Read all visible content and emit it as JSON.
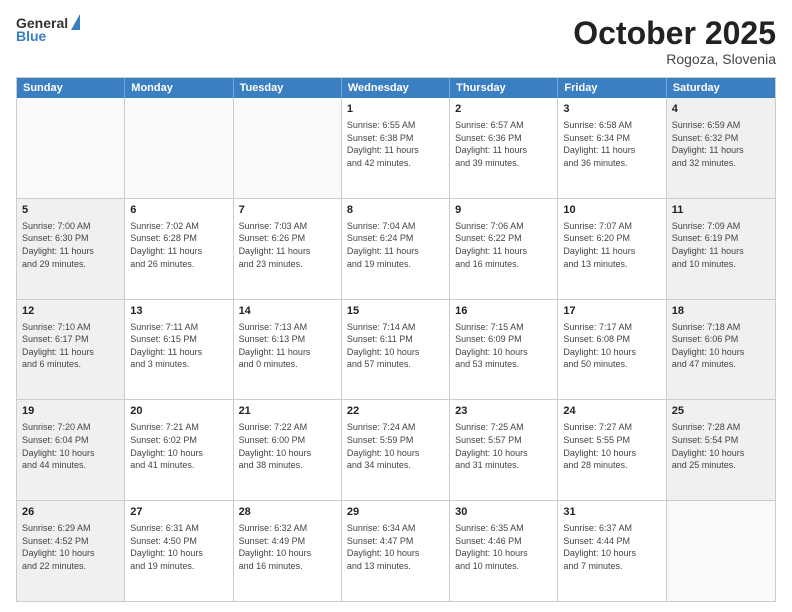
{
  "logo": {
    "line1": "General",
    "line2": "Blue"
  },
  "header": {
    "month": "October 2025",
    "location": "Rogoza, Slovenia"
  },
  "weekdays": [
    "Sunday",
    "Monday",
    "Tuesday",
    "Wednesday",
    "Thursday",
    "Friday",
    "Saturday"
  ],
  "rows": [
    [
      {
        "day": "",
        "info": "",
        "empty": true
      },
      {
        "day": "",
        "info": "",
        "empty": true
      },
      {
        "day": "",
        "info": "",
        "empty": true
      },
      {
        "day": "1",
        "info": "Sunrise: 6:55 AM\nSunset: 6:38 PM\nDaylight: 11 hours\nand 42 minutes.",
        "shaded": false
      },
      {
        "day": "2",
        "info": "Sunrise: 6:57 AM\nSunset: 6:36 PM\nDaylight: 11 hours\nand 39 minutes.",
        "shaded": false
      },
      {
        "day": "3",
        "info": "Sunrise: 6:58 AM\nSunset: 6:34 PM\nDaylight: 11 hours\nand 36 minutes.",
        "shaded": false
      },
      {
        "day": "4",
        "info": "Sunrise: 6:59 AM\nSunset: 6:32 PM\nDaylight: 11 hours\nand 32 minutes.",
        "shaded": true
      }
    ],
    [
      {
        "day": "5",
        "info": "Sunrise: 7:00 AM\nSunset: 6:30 PM\nDaylight: 11 hours\nand 29 minutes.",
        "shaded": true
      },
      {
        "day": "6",
        "info": "Sunrise: 7:02 AM\nSunset: 6:28 PM\nDaylight: 11 hours\nand 26 minutes.",
        "shaded": false
      },
      {
        "day": "7",
        "info": "Sunrise: 7:03 AM\nSunset: 6:26 PM\nDaylight: 11 hours\nand 23 minutes.",
        "shaded": false
      },
      {
        "day": "8",
        "info": "Sunrise: 7:04 AM\nSunset: 6:24 PM\nDaylight: 11 hours\nand 19 minutes.",
        "shaded": false
      },
      {
        "day": "9",
        "info": "Sunrise: 7:06 AM\nSunset: 6:22 PM\nDaylight: 11 hours\nand 16 minutes.",
        "shaded": false
      },
      {
        "day": "10",
        "info": "Sunrise: 7:07 AM\nSunset: 6:20 PM\nDaylight: 11 hours\nand 13 minutes.",
        "shaded": false
      },
      {
        "day": "11",
        "info": "Sunrise: 7:09 AM\nSunset: 6:19 PM\nDaylight: 11 hours\nand 10 minutes.",
        "shaded": true
      }
    ],
    [
      {
        "day": "12",
        "info": "Sunrise: 7:10 AM\nSunset: 6:17 PM\nDaylight: 11 hours\nand 6 minutes.",
        "shaded": true
      },
      {
        "day": "13",
        "info": "Sunrise: 7:11 AM\nSunset: 6:15 PM\nDaylight: 11 hours\nand 3 minutes.",
        "shaded": false
      },
      {
        "day": "14",
        "info": "Sunrise: 7:13 AM\nSunset: 6:13 PM\nDaylight: 11 hours\nand 0 minutes.",
        "shaded": false
      },
      {
        "day": "15",
        "info": "Sunrise: 7:14 AM\nSunset: 6:11 PM\nDaylight: 10 hours\nand 57 minutes.",
        "shaded": false
      },
      {
        "day": "16",
        "info": "Sunrise: 7:15 AM\nSunset: 6:09 PM\nDaylight: 10 hours\nand 53 minutes.",
        "shaded": false
      },
      {
        "day": "17",
        "info": "Sunrise: 7:17 AM\nSunset: 6:08 PM\nDaylight: 10 hours\nand 50 minutes.",
        "shaded": false
      },
      {
        "day": "18",
        "info": "Sunrise: 7:18 AM\nSunset: 6:06 PM\nDaylight: 10 hours\nand 47 minutes.",
        "shaded": true
      }
    ],
    [
      {
        "day": "19",
        "info": "Sunrise: 7:20 AM\nSunset: 6:04 PM\nDaylight: 10 hours\nand 44 minutes.",
        "shaded": true
      },
      {
        "day": "20",
        "info": "Sunrise: 7:21 AM\nSunset: 6:02 PM\nDaylight: 10 hours\nand 41 minutes.",
        "shaded": false
      },
      {
        "day": "21",
        "info": "Sunrise: 7:22 AM\nSunset: 6:00 PM\nDaylight: 10 hours\nand 38 minutes.",
        "shaded": false
      },
      {
        "day": "22",
        "info": "Sunrise: 7:24 AM\nSunset: 5:59 PM\nDaylight: 10 hours\nand 34 minutes.",
        "shaded": false
      },
      {
        "day": "23",
        "info": "Sunrise: 7:25 AM\nSunset: 5:57 PM\nDaylight: 10 hours\nand 31 minutes.",
        "shaded": false
      },
      {
        "day": "24",
        "info": "Sunrise: 7:27 AM\nSunset: 5:55 PM\nDaylight: 10 hours\nand 28 minutes.",
        "shaded": false
      },
      {
        "day": "25",
        "info": "Sunrise: 7:28 AM\nSunset: 5:54 PM\nDaylight: 10 hours\nand 25 minutes.",
        "shaded": true
      }
    ],
    [
      {
        "day": "26",
        "info": "Sunrise: 6:29 AM\nSunset: 4:52 PM\nDaylight: 10 hours\nand 22 minutes.",
        "shaded": true
      },
      {
        "day": "27",
        "info": "Sunrise: 6:31 AM\nSunset: 4:50 PM\nDaylight: 10 hours\nand 19 minutes.",
        "shaded": false
      },
      {
        "day": "28",
        "info": "Sunrise: 6:32 AM\nSunset: 4:49 PM\nDaylight: 10 hours\nand 16 minutes.",
        "shaded": false
      },
      {
        "day": "29",
        "info": "Sunrise: 6:34 AM\nSunset: 4:47 PM\nDaylight: 10 hours\nand 13 minutes.",
        "shaded": false
      },
      {
        "day": "30",
        "info": "Sunrise: 6:35 AM\nSunset: 4:46 PM\nDaylight: 10 hours\nand 10 minutes.",
        "shaded": false
      },
      {
        "day": "31",
        "info": "Sunrise: 6:37 AM\nSunset: 4:44 PM\nDaylight: 10 hours\nand 7 minutes.",
        "shaded": false
      },
      {
        "day": "",
        "info": "",
        "empty": true
      }
    ]
  ]
}
